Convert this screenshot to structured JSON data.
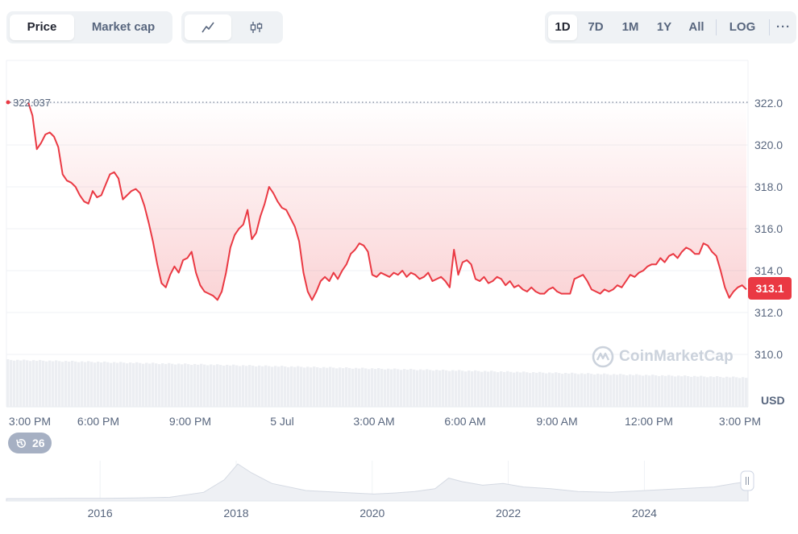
{
  "toolbar": {
    "metric_tabs": [
      {
        "label": "Price",
        "active": true
      },
      {
        "label": "Market cap",
        "active": false
      }
    ],
    "chart_type_icons": [
      "line-chart-icon",
      "candlestick-icon"
    ],
    "ranges": [
      {
        "label": "1D",
        "active": true
      },
      {
        "label": "7D",
        "active": false
      },
      {
        "label": "1M",
        "active": false
      },
      {
        "label": "1Y",
        "active": false
      },
      {
        "label": "All",
        "active": false
      }
    ],
    "log_label": "LOG",
    "more_label": "···"
  },
  "chart": {
    "start_price_label": "322.037",
    "current_price_label": "313.1",
    "currency_label": "USD",
    "watermark": "CoinMarketCap",
    "history_badge_count": "26"
  },
  "colors": {
    "line": "#ea3943",
    "accent_tag": "#ea3943",
    "grid": "#eff2f5",
    "axis_text": "#58667e",
    "volume": "#eceef2",
    "overview_fill": "#eef0f4"
  },
  "chart_data": [
    {
      "type": "line",
      "ylim": [
        309,
        324
      ],
      "yticks": [
        310.0,
        312.0,
        314.0,
        316.0,
        318.0,
        320.0,
        322.0
      ],
      "ytick_labels": [
        "310.0",
        "312.0",
        "314.0",
        "316.0",
        "318.0",
        "320.0",
        "322.0"
      ],
      "xtick_labels": [
        "3:00 PM",
        "6:00 PM",
        "9:00 PM",
        "5 Jul",
        "3:00 AM",
        "6:00 AM",
        "9:00 AM",
        "12:00 PM",
        "3:00 PM"
      ],
      "reference_line": 322.037,
      "xlabel": "",
      "ylabel": "USD",
      "grid": true,
      "series": [
        {
          "values": [
            322.04,
            321.4,
            319.8,
            320.1,
            320.5,
            320.6,
            320.4,
            319.9,
            318.6,
            318.3,
            318.2,
            318.0,
            317.6,
            317.3,
            317.2,
            317.8,
            317.5,
            317.6,
            318.1,
            318.6,
            318.7,
            318.4,
            317.4,
            317.6,
            317.8,
            317.9,
            317.7,
            317.1,
            316.3,
            315.4,
            314.3,
            313.4,
            313.2,
            313.8,
            314.2,
            313.9,
            314.5,
            314.6,
            314.9,
            313.9,
            313.3,
            313.0,
            312.9,
            312.8,
            312.6,
            313.0,
            313.9,
            315.1,
            315.7,
            316.0,
            316.2,
            316.9,
            315.5,
            315.8,
            316.6,
            317.2,
            318.0,
            317.7,
            317.3,
            317.0,
            316.9,
            316.5,
            316.1,
            315.4,
            313.9,
            313.0,
            312.6,
            313.0,
            313.5,
            313.7,
            313.5,
            313.9,
            313.6,
            314.0,
            314.3,
            314.8,
            315.0,
            315.3,
            315.2,
            314.9,
            313.8,
            313.7,
            313.9,
            313.8,
            313.7,
            313.9,
            313.8,
            314.0,
            313.7,
            313.9,
            313.8,
            313.6,
            313.7,
            313.9,
            313.5,
            313.6,
            313.7,
            313.5,
            313.2,
            315.0,
            313.8,
            314.4,
            314.5,
            314.3,
            313.6,
            313.5,
            313.7,
            313.4,
            313.5,
            313.7,
            313.6,
            313.3,
            313.5,
            313.2,
            313.3,
            313.1,
            313.0,
            313.2,
            313.0,
            312.9,
            312.9,
            313.1,
            313.2,
            313.0,
            312.9,
            312.9,
            312.9,
            313.6,
            313.7,
            313.8,
            313.5,
            313.1,
            313.0,
            312.9,
            313.1,
            313.0,
            313.1,
            313.3,
            313.2,
            313.5,
            313.8,
            313.7,
            313.9,
            314.0,
            314.2,
            314.3,
            314.3,
            314.6,
            314.4,
            314.7,
            314.8,
            314.6,
            314.9,
            315.1,
            315.0,
            314.8,
            314.8,
            315.3,
            315.2,
            314.9,
            314.7,
            314.0,
            313.2,
            312.7,
            313.0,
            313.2,
            313.3,
            313.1
          ]
        }
      ]
    },
    {
      "type": "area",
      "xtick_labels": [
        "2016",
        "2018",
        "2020",
        "2022",
        "2024"
      ],
      "x": [
        2014.6,
        2015.0,
        2015.5,
        2016.0,
        2016.5,
        2017.0,
        2017.5,
        2017.8,
        2018.0,
        2018.2,
        2018.5,
        2019.0,
        2019.5,
        2020.0,
        2020.3,
        2020.6,
        2020.9,
        2021.1,
        2021.3,
        2021.6,
        2021.9,
        2022.2,
        2022.6,
        2023.0,
        2023.5,
        2024.0,
        2024.5,
        2025.0,
        2025.3,
        2025.5
      ],
      "values": [
        0.02,
        0.02,
        0.03,
        0.03,
        0.04,
        0.06,
        0.2,
        0.55,
        1.0,
        0.75,
        0.45,
        0.25,
        0.2,
        0.15,
        0.18,
        0.22,
        0.3,
        0.6,
        0.5,
        0.4,
        0.45,
        0.35,
        0.3,
        0.22,
        0.2,
        0.25,
        0.3,
        0.35,
        0.45,
        0.5
      ]
    }
  ]
}
